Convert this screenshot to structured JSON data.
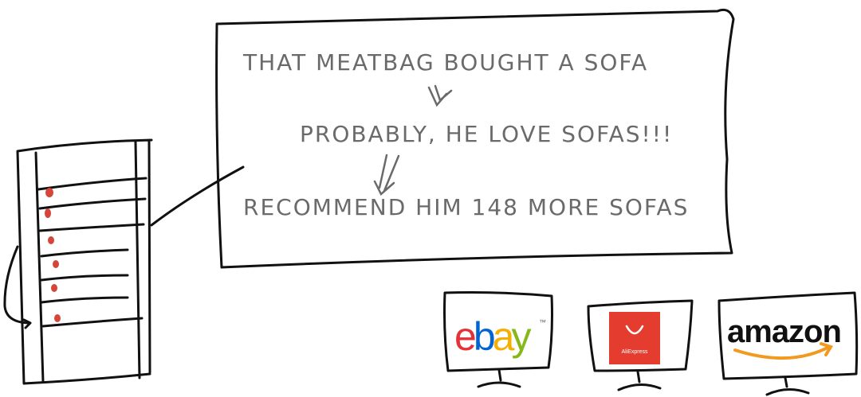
{
  "speech_bubble": {
    "line1": "THAT MEATBAG BOUGHT A SOFA",
    "line2": "PROBABLY, HE LOVE SOFAS!!!",
    "line3": "RECOMMEND HIM 148 MORE SOFAS"
  },
  "monitors": {
    "ebay": {
      "logo_text": "ebay",
      "trademark": "™"
    },
    "aliexpress": {
      "logo_text": "AliExpress"
    },
    "amazon": {
      "logo_text": "amazon"
    }
  },
  "colors": {
    "ink": "#111111",
    "text_gray": "#6a6a6a",
    "server_light": "#d6453a",
    "ebay_e": "#e53238",
    "ebay_b": "#0064d2",
    "ebay_a": "#f5af02",
    "ebay_y": "#86b817",
    "ali_red": "#e43d30",
    "amazon_orange": "#f29a1f"
  }
}
